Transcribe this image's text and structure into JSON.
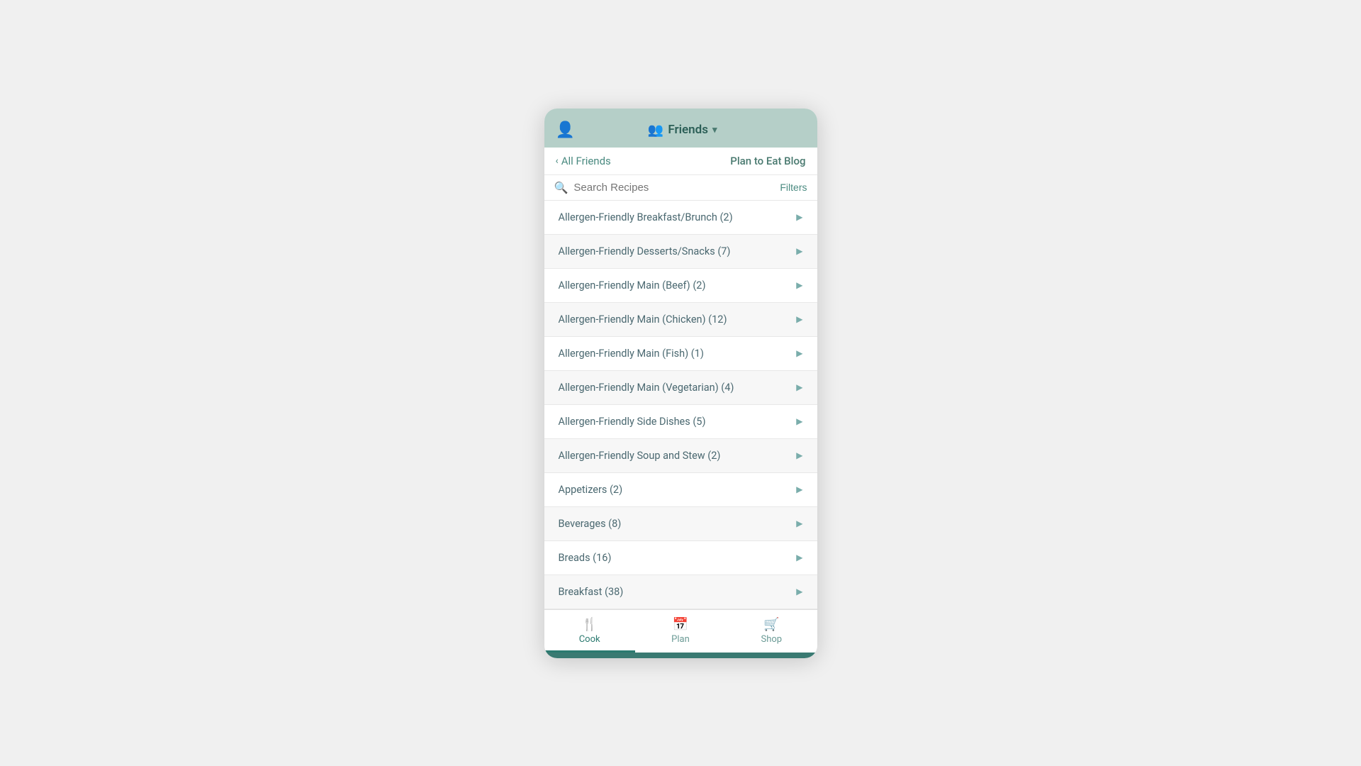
{
  "header": {
    "user_icon": "👤",
    "friends_icon": "👥",
    "title": "Friends",
    "chevron": "▾"
  },
  "sub_nav": {
    "back_label": "All Friends",
    "blog_label": "Plan to Eat Blog"
  },
  "search": {
    "placeholder": "Search Recipes",
    "filters_label": "Filters"
  },
  "recipe_categories": [
    {
      "label": "Allergen-Friendly Breakfast/Brunch (2)"
    },
    {
      "label": "Allergen-Friendly Desserts/Snacks (7)"
    },
    {
      "label": "Allergen-Friendly Main (Beef) (2)"
    },
    {
      "label": "Allergen-Friendly Main (Chicken) (12)"
    },
    {
      "label": "Allergen-Friendly Main (Fish) (1)"
    },
    {
      "label": "Allergen-Friendly Main (Vegetarian) (4)"
    },
    {
      "label": "Allergen-Friendly Side Dishes (5)"
    },
    {
      "label": "Allergen-Friendly Soup and Stew (2)"
    },
    {
      "label": "Appetizers (2)"
    },
    {
      "label": "Beverages (8)"
    },
    {
      "label": "Breads (16)"
    },
    {
      "label": "Breakfast (38)"
    }
  ],
  "tabs": [
    {
      "id": "cook",
      "icon": "🍴",
      "label": "Cook",
      "active": true
    },
    {
      "id": "plan",
      "icon": "📅",
      "label": "Plan",
      "active": false
    },
    {
      "id": "shop",
      "icon": "🛒",
      "label": "Shop",
      "active": false
    }
  ]
}
